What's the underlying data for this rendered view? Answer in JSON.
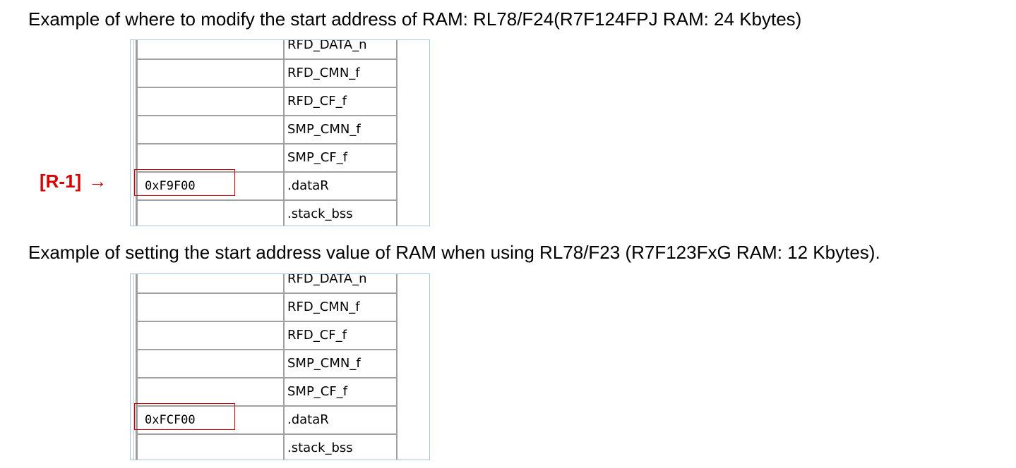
{
  "captions": {
    "first": "Example of where to modify the start address of RAM: RL78/F24(R7F124FPJ RAM: 24 Kbytes)",
    "second": "Example of setting the start address value of RAM when using RL78/F23 (R7F123FxG RAM: 12 Kbytes)."
  },
  "marker": {
    "label": "[R-1]",
    "arrow": "→",
    "color": "#d90000"
  },
  "tables": [
    {
      "rows": [
        {
          "address": "",
          "section": "RFD_DATA_n"
        },
        {
          "address": "",
          "section": "RFD_CMN_f"
        },
        {
          "address": "",
          "section": "RFD_CF_f"
        },
        {
          "address": "",
          "section": "SMP_CMN_f"
        },
        {
          "address": "",
          "section": "SMP_CF_f"
        },
        {
          "address": "0xF9F00",
          "section": ".dataR",
          "highlighted": true
        },
        {
          "address": "",
          "section": ".stack_bss"
        }
      ]
    },
    {
      "rows": [
        {
          "address": "",
          "section": "RFD_DATA_n"
        },
        {
          "address": "",
          "section": "RFD_CMN_f"
        },
        {
          "address": "",
          "section": "RFD_CF_f"
        },
        {
          "address": "",
          "section": "SMP_CMN_f"
        },
        {
          "address": "",
          "section": "SMP_CF_f"
        },
        {
          "address": "0xFCF00",
          "section": ".dataR",
          "highlighted": true
        },
        {
          "address": "",
          "section": ".stack_bss"
        }
      ]
    }
  ]
}
